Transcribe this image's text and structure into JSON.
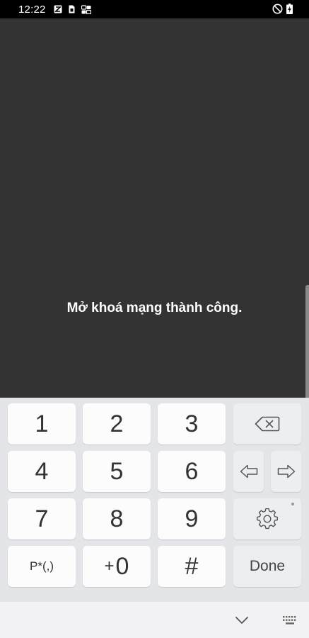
{
  "status_bar": {
    "time": "12:22",
    "left_icons": [
      "app-notification-icon",
      "sim-icon",
      "network-icon"
    ],
    "right_icons": [
      "do-not-disturb-icon",
      "battery-charging-icon"
    ]
  },
  "screen": {
    "message": "Mở khoá mạng thành công."
  },
  "keypad": {
    "keys": {
      "k1": "1",
      "k2": "2",
      "k3": "3",
      "k4": "4",
      "k5": "5",
      "k6": "6",
      "k7": "7",
      "k8": "8",
      "k9": "9",
      "special": "P*(,)",
      "plus": "+",
      "k0": "0",
      "hash": "#",
      "done": "Done"
    },
    "icons": [
      "backspace-icon",
      "arrow-left-icon",
      "arrow-right-icon",
      "settings-icon"
    ]
  },
  "nav_bar": {
    "icons": [
      "hide-keyboard-icon",
      "keyboard-switch-icon"
    ]
  },
  "colors": {
    "status_bar": "#000000",
    "screen_background": "#333333",
    "keyboard_background": "#e4e5e9",
    "key_background": "#fcfcfd",
    "function_key_background": "#eceef1",
    "nav_bar_background": "#f2f2f4"
  }
}
